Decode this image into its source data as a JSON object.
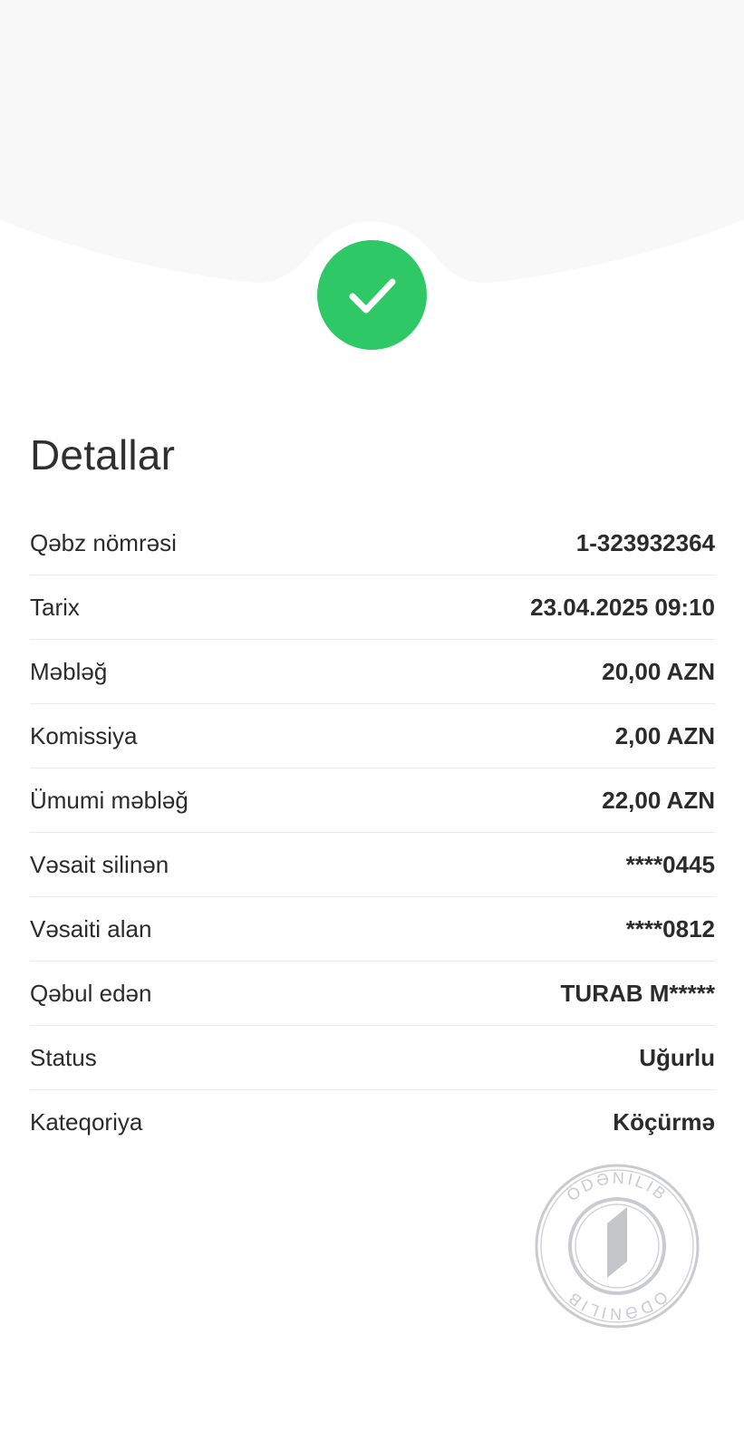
{
  "header": {
    "status_icon": "check-icon",
    "accent_color": "#2ec866",
    "background_color": "#f8f8f8"
  },
  "details": {
    "title": "Detallar",
    "rows": [
      {
        "label": "Qəbz nömrəsi",
        "value": "1-323932364"
      },
      {
        "label": "Tarix",
        "value": "23.04.2025 09:10"
      },
      {
        "label": "Məbləğ",
        "value": "20,00 AZN"
      },
      {
        "label": "Komissiya",
        "value": "2,00 AZN"
      },
      {
        "label": "Ümumi məbləğ",
        "value": "22,00 AZN"
      },
      {
        "label": "Vəsait silinən",
        "value": "****0445"
      },
      {
        "label": "Vəsaiti alan",
        "value": "****0812"
      },
      {
        "label": "Qəbul edən",
        "value": "TURAB M*****"
      },
      {
        "label": "Status",
        "value": "Uğurlu"
      },
      {
        "label": "Kateqoriya",
        "value": "Köçürmə"
      }
    ]
  },
  "stamp": {
    "text": "ÖDƏNİLİB",
    "icon": "paid-stamp-icon"
  }
}
